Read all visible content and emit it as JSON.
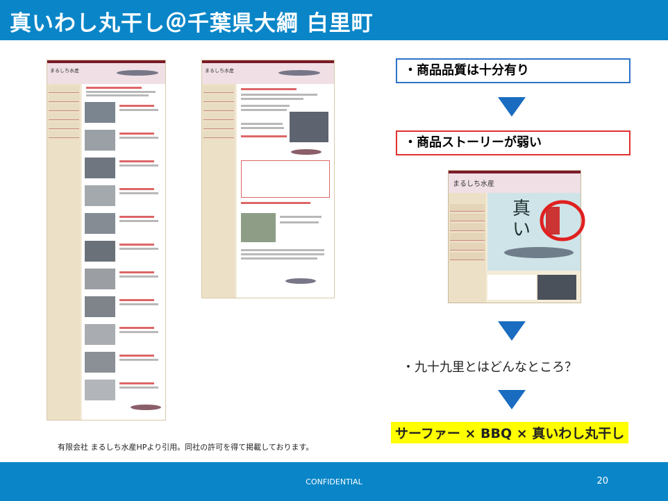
{
  "slide": {
    "title": "真いわし丸干し＠千葉県大綱 白里町",
    "footer_label": "CONFIDENTIAL",
    "page_number": "20",
    "credit": "有限会社 まるしち水産HPより引用。同社の許可を得て掲載しております。"
  },
  "thumbnails": {
    "site_logo": "まるしち水産",
    "shot_logo": "まるしち水産"
  },
  "flow": {
    "quality": "・商品品質は十分有り",
    "story": "・商品ストーリーが弱い",
    "question": "・九十九里とはどんなところ？",
    "conclusion": "サーファー × BBQ × 真いわし丸干し"
  },
  "colors": {
    "header_bar": "#0a86c8",
    "quality_border": "#2a74c8",
    "story_border": "#e03030",
    "arrow": "#1a6cc0",
    "highlight": "#ffff00"
  },
  "icons": [
    "down-arrow-icon",
    "red-circle-highlight-icon"
  ]
}
